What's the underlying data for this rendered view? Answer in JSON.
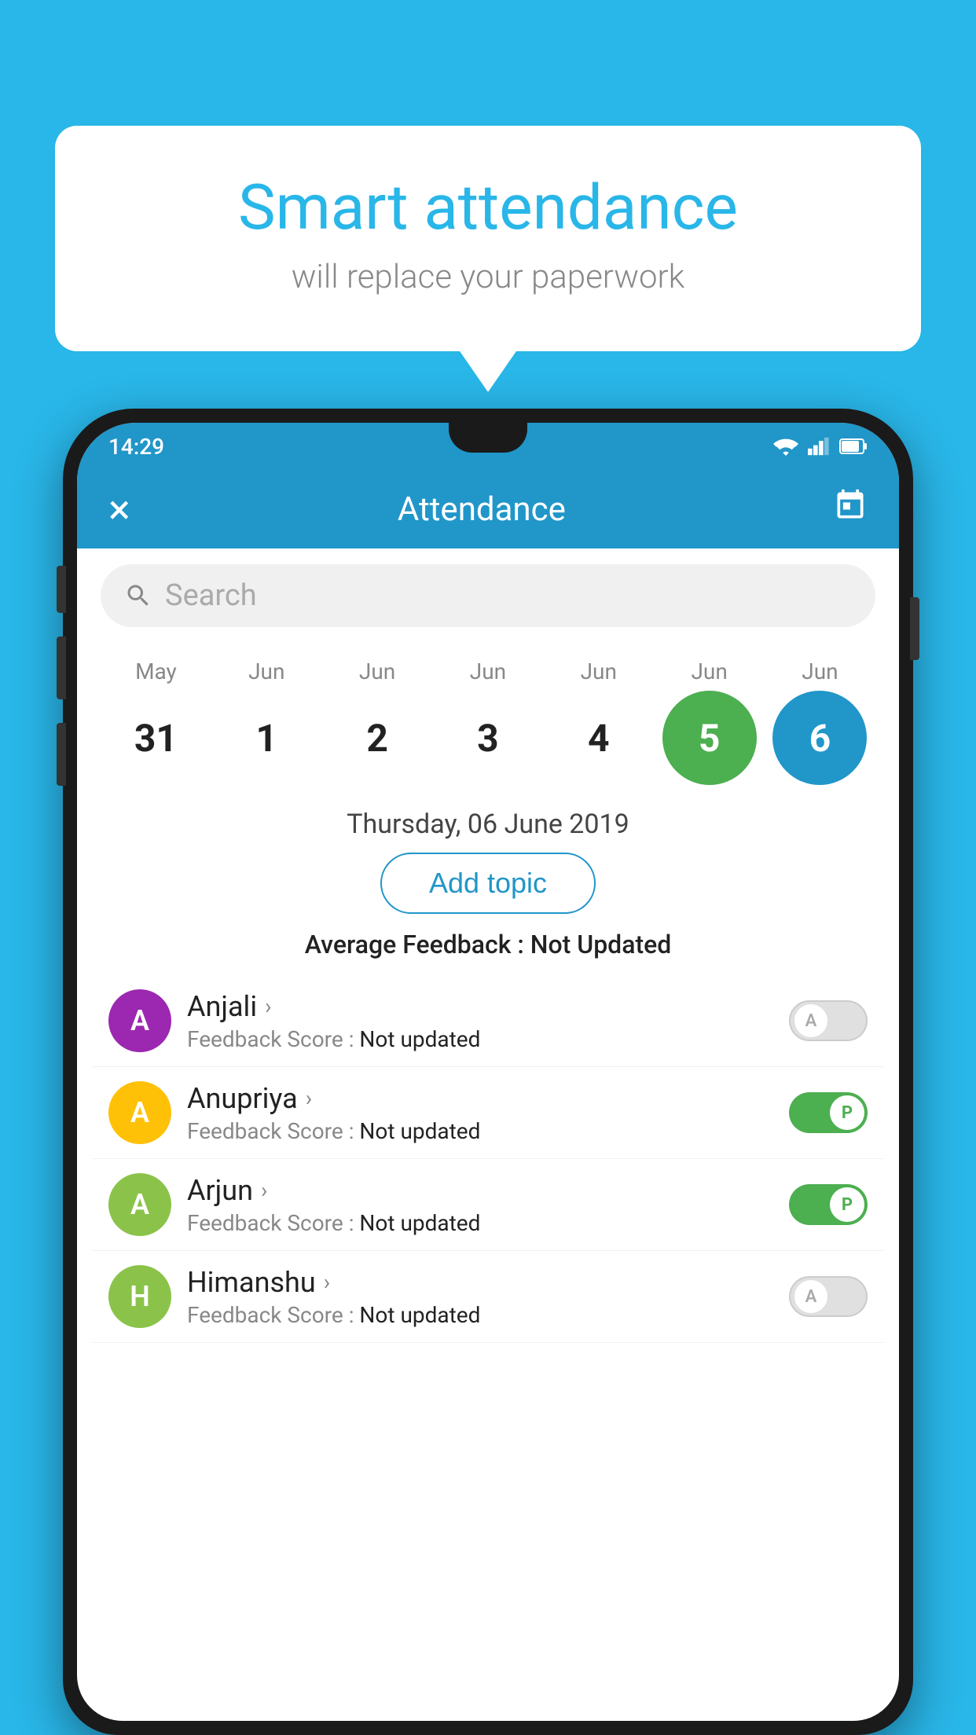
{
  "background_color": "#29b6e8",
  "speech_bubble": {
    "title": "Smart attendance",
    "subtitle": "will replace your paperwork"
  },
  "status_bar": {
    "time": "14:29"
  },
  "app_bar": {
    "title": "Attendance",
    "close_label": "×",
    "calendar_icon": "📅"
  },
  "search": {
    "placeholder": "Search"
  },
  "calendar": {
    "months": [
      "May",
      "Jun",
      "Jun",
      "Jun",
      "Jun",
      "Jun",
      "Jun"
    ],
    "dates": [
      "31",
      "1",
      "2",
      "3",
      "4",
      "5",
      "6"
    ],
    "today_index": 4,
    "selected_index": 5,
    "selected_date_label": "Thursday, 06 June 2019"
  },
  "add_topic_button": "Add topic",
  "avg_feedback": {
    "label": "Average Feedback : ",
    "value": "Not Updated"
  },
  "students": [
    {
      "name": "Anjali",
      "avatar_letter": "A",
      "avatar_color": "#9c27b0",
      "feedback_label": "Feedback Score : ",
      "feedback_value": "Not updated",
      "toggle_state": "off",
      "toggle_label": "A"
    },
    {
      "name": "Anupriya",
      "avatar_letter": "A",
      "avatar_color": "#ffc107",
      "feedback_label": "Feedback Score : ",
      "feedback_value": "Not updated",
      "toggle_state": "on",
      "toggle_label": "P"
    },
    {
      "name": "Arjun",
      "avatar_letter": "A",
      "avatar_color": "#8bc34a",
      "feedback_label": "Feedback Score : ",
      "feedback_value": "Not updated",
      "toggle_state": "on",
      "toggle_label": "P"
    },
    {
      "name": "Himanshu",
      "avatar_letter": "H",
      "avatar_color": "#8bc34a",
      "feedback_label": "Feedback Score : ",
      "feedback_value": "Not updated",
      "toggle_state": "off",
      "toggle_label": "A"
    }
  ]
}
